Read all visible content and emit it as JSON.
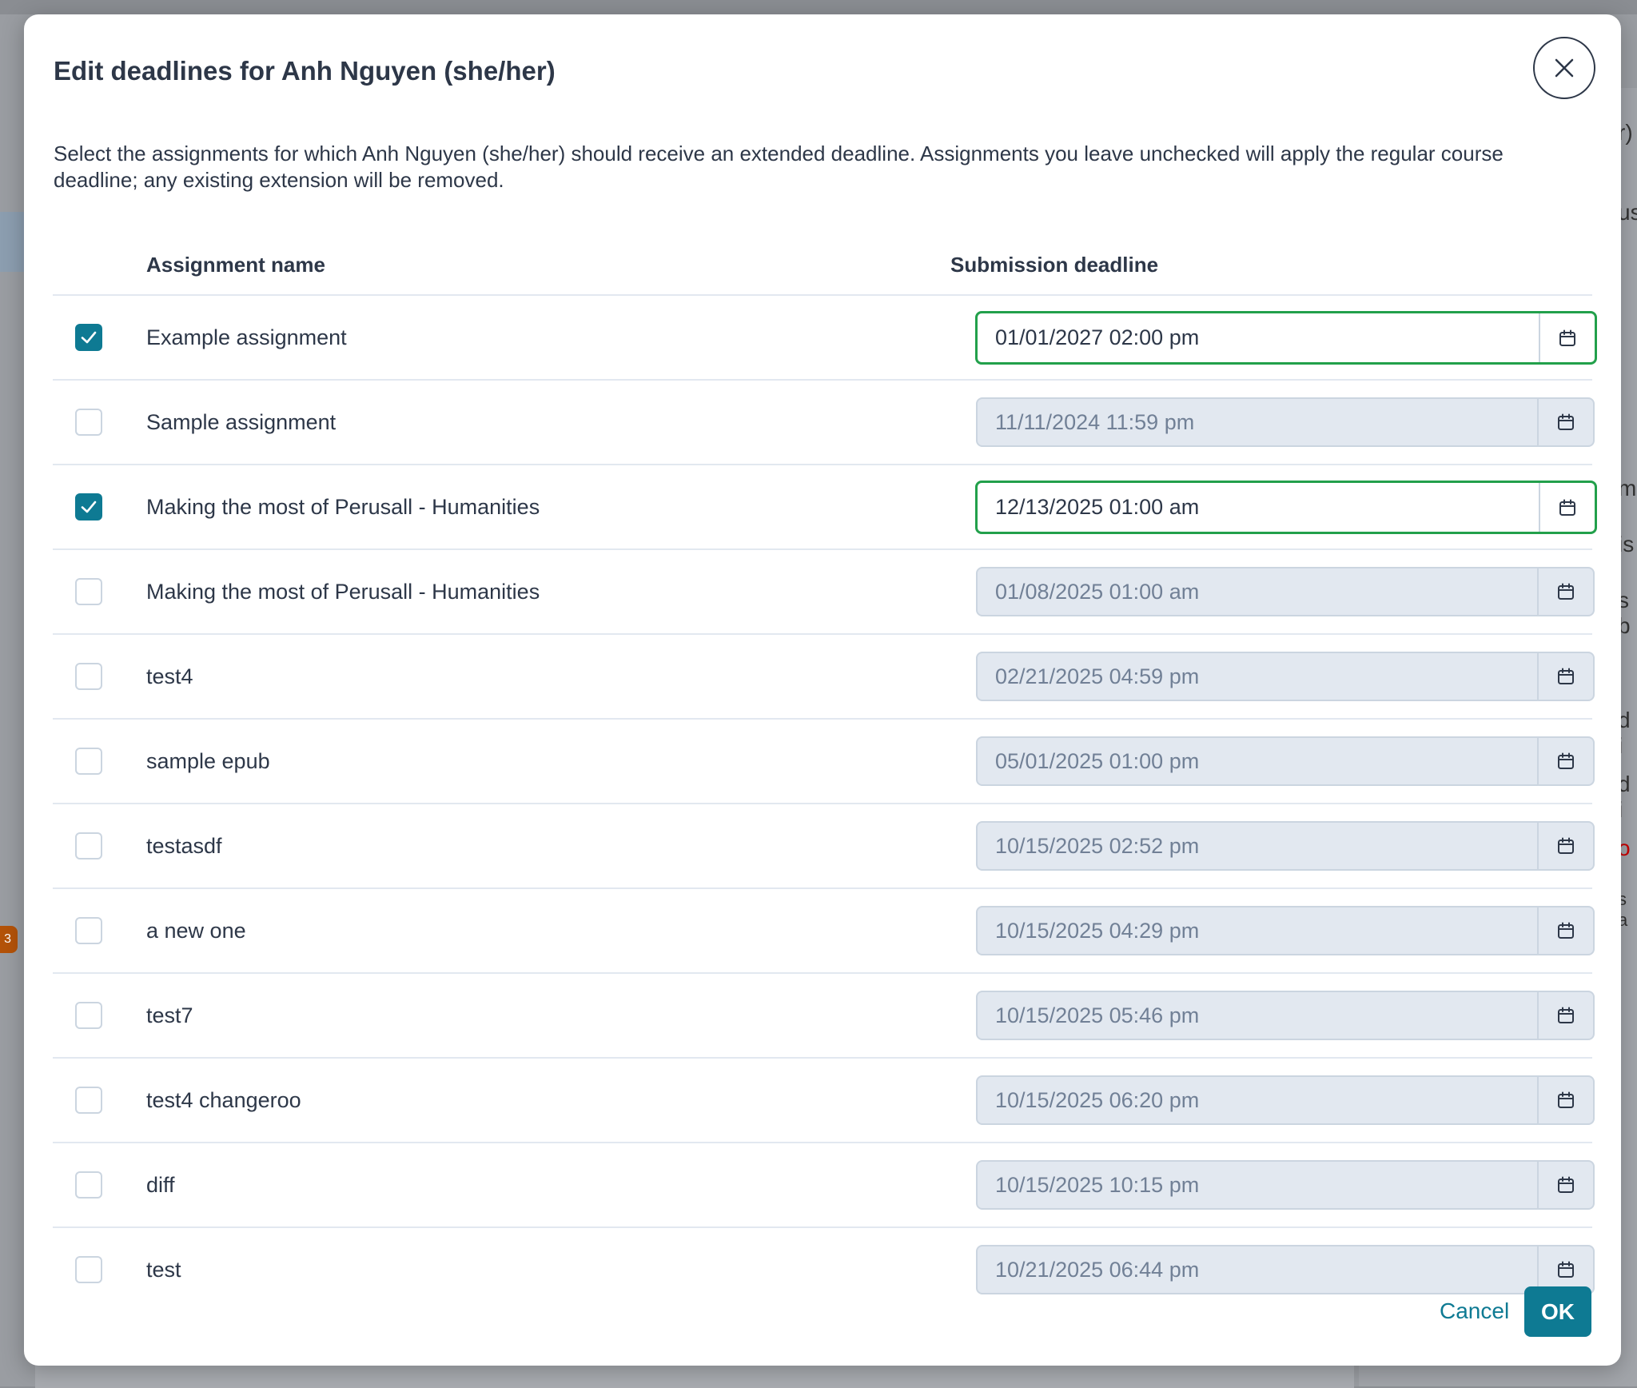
{
  "background": {
    "badge": "3",
    "fragments": [
      "r)",
      "us",
      "m",
      "is",
      "s b",
      "d i",
      "d i",
      "o",
      "s a"
    ]
  },
  "modal": {
    "title": "Edit deadlines for Anh Nguyen (she/her)",
    "description": "Select the assignments for which Anh Nguyen (she/her) should receive an extended deadline. Assignments you leave unchecked will apply the regular course deadline; any existing extension will be removed.",
    "columns": {
      "name": "Assignment name",
      "deadline": "Submission deadline"
    },
    "rows": [
      {
        "name": "Example assignment",
        "deadline": "01/01/2027 02:00 pm",
        "checked": true
      },
      {
        "name": "Sample assignment",
        "deadline": "11/11/2024 11:59 pm",
        "checked": false
      },
      {
        "name": "Making the most of Perusall - Humanities",
        "deadline": "12/13/2025 01:00 am",
        "checked": true
      },
      {
        "name": "Making the most of Perusall - Humanities",
        "deadline": "01/08/2025 01:00 am",
        "checked": false
      },
      {
        "name": "test4",
        "deadline": "02/21/2025 04:59 pm",
        "checked": false
      },
      {
        "name": "sample epub",
        "deadline": "05/01/2025 01:00 pm",
        "checked": false
      },
      {
        "name": "testasdf",
        "deadline": "10/15/2025 02:52 pm",
        "checked": false
      },
      {
        "name": "a new one",
        "deadline": "10/15/2025 04:29 pm",
        "checked": false
      },
      {
        "name": "test7",
        "deadline": "10/15/2025 05:46 pm",
        "checked": false
      },
      {
        "name": "test4 changeroo",
        "deadline": "10/15/2025 06:20 pm",
        "checked": false
      },
      {
        "name": "diff",
        "deadline": "10/15/2025 10:15 pm",
        "checked": false
      },
      {
        "name": "test",
        "deadline": "10/21/2025 06:44 pm",
        "checked": false
      }
    ],
    "cancel_label": "Cancel",
    "ok_label": "OK"
  },
  "colors": {
    "accent": "#0e7a93",
    "active_border": "#22a04b",
    "disabled_bg": "#e2e8f0"
  },
  "icons": {
    "close": "close-icon",
    "calendar": "calendar-icon",
    "check": "check-icon"
  }
}
